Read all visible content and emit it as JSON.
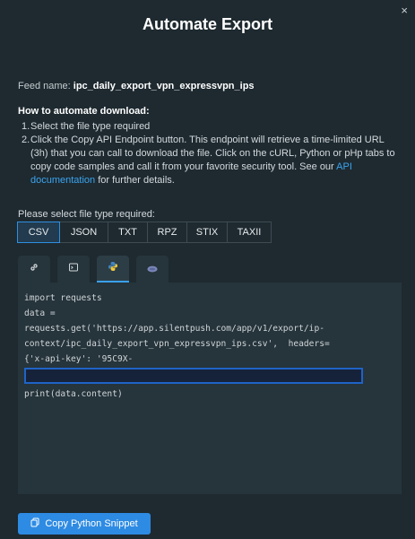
{
  "modal": {
    "title": "Automate Export",
    "close_glyph": "×"
  },
  "feed": {
    "label": "Feed name:",
    "value": "ipc_daily_export_vpn_expressvpn_ips"
  },
  "instructions": {
    "heading": "How to automate download:",
    "step1_num": "1.",
    "step1": "Select the file type required",
    "step2_num": "2.",
    "step2_text": "Click the Copy API Endpoint button. This endpoint will retrieve a time-limited URL (3h) that you can call to download the file. Click on the cURL, Python or pHp tabs to copy code samples and call it from your favorite security tool. See our ",
    "step2_link": "API documentation",
    "step2_tail": " for further details."
  },
  "filetype": {
    "label": "Please select file type required:",
    "options": [
      "CSV",
      "JSON",
      "TXT",
      "RPZ",
      "STIX",
      "TAXII"
    ],
    "selected": "CSV"
  },
  "tabs": [
    {
      "icon": "link-icon",
      "active": false
    },
    {
      "icon": "terminal-icon",
      "active": false
    },
    {
      "icon": "python-icon",
      "active": true
    },
    {
      "icon": "php-icon",
      "active": false
    }
  ],
  "code": {
    "line1": "import requests",
    "line2": "data =",
    "line3": "requests.get('https://app.silentpush.com/app/v1/export/ip-",
    "line4": "context/ipc_daily_export_vpn_expressvpn_ips.csv',  headers=",
    "line5": "{'x-api-key': '95C9X-",
    "line6": "print(data.content)"
  },
  "copy_button": {
    "label": "Copy Python Snippet",
    "icon": "copy-icon"
  },
  "colors": {
    "background": "#1e2a30",
    "accent": "#2e8be3",
    "code_bg": "#26343b"
  }
}
